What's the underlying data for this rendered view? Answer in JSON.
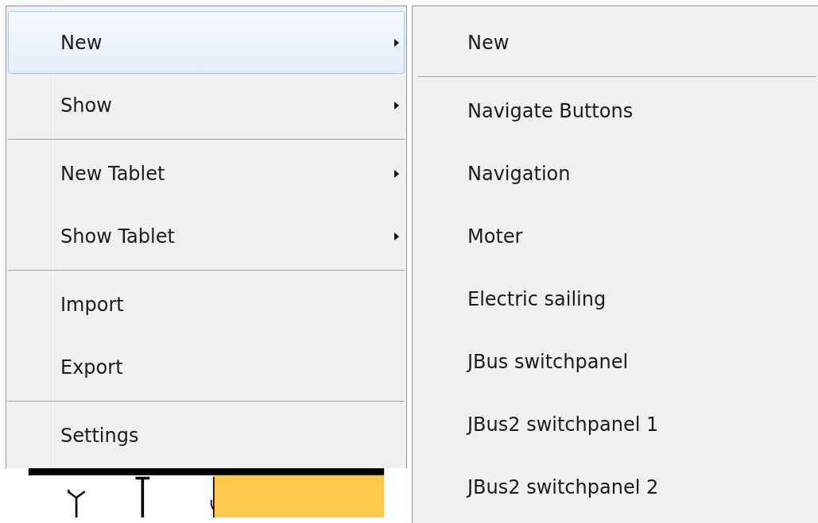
{
  "menu": {
    "items": [
      {
        "kind": "submenu",
        "label": "New",
        "selected": true
      },
      {
        "kind": "submenu",
        "label": "Show",
        "selected": false
      },
      {
        "kind": "separator"
      },
      {
        "kind": "submenu",
        "label": "New Tablet",
        "selected": false
      },
      {
        "kind": "submenu",
        "label": "Show Tablet",
        "selected": false
      },
      {
        "kind": "separator"
      },
      {
        "kind": "item",
        "label": "Import",
        "selected": false
      },
      {
        "kind": "item",
        "label": "Export",
        "selected": false
      },
      {
        "kind": "separator"
      },
      {
        "kind": "item",
        "label": "Settings",
        "selected": false
      }
    ]
  },
  "submenu": {
    "items": [
      {
        "kind": "item",
        "label": "New",
        "selected": false
      },
      {
        "kind": "separator"
      },
      {
        "kind": "item",
        "label": "Navigate Buttons",
        "selected": false
      },
      {
        "kind": "item",
        "label": "Navigation",
        "selected": false
      },
      {
        "kind": "item",
        "label": "Moter",
        "selected": false
      },
      {
        "kind": "item",
        "label": "Electric sailing",
        "selected": false
      },
      {
        "kind": "item",
        "label": "JBus switchpanel",
        "selected": false
      },
      {
        "kind": "item",
        "label": "JBus2 switchpanel 1",
        "selected": false
      },
      {
        "kind": "item",
        "label": "JBus2 switchpanel 2",
        "selected": false
      }
    ]
  }
}
